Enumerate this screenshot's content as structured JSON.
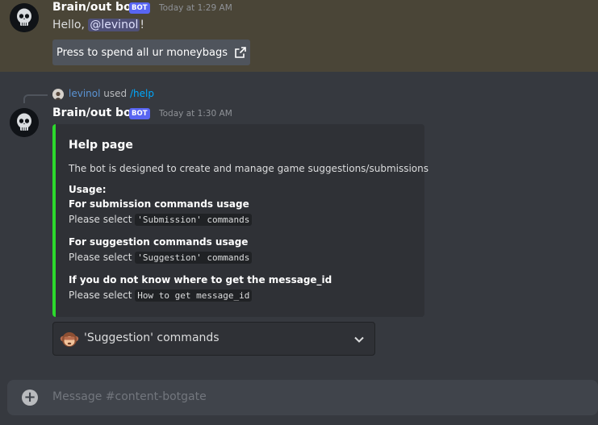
{
  "message1": {
    "author": "Brain/out bot",
    "bot_tag": "BOT",
    "timestamp": "Today at 1:29 AM",
    "greeting": "Hello,",
    "mention": "@levinol",
    "greeting_end": "!",
    "link_button_label": "Press to spend all ur moneybags",
    "link_icon": "external-link-icon"
  },
  "message2": {
    "reply_user": "levinol",
    "reply_used": "used",
    "reply_command": "/help",
    "author": "Brain/out bot",
    "bot_tag": "BOT",
    "timestamp": "Today at 1:30 AM",
    "embed": {
      "accent_color": "#2cd92c",
      "title": "Help page",
      "description": "The bot is designed to create and manage game suggestions/submissions",
      "usage_label": "Usage:",
      "sections": [
        {
          "heading": "For submission commands usage",
          "prefix": "Please select",
          "code": "'Submission' commands"
        },
        {
          "heading": "For suggestion commands usage",
          "prefix": "Please select",
          "code": "'Suggestion' commands"
        },
        {
          "heading": "If you do not know where to get the message_id",
          "prefix": "Please select",
          "code": "How to get message_id"
        }
      ]
    },
    "select_menu": {
      "emoji": "monkey-face-icon",
      "selected": "'Suggestion' commands",
      "chevron": "chevron-down-icon"
    }
  },
  "composer": {
    "placeholder": "Message #content-botgate",
    "add_icon": "plus-circle-icon"
  }
}
